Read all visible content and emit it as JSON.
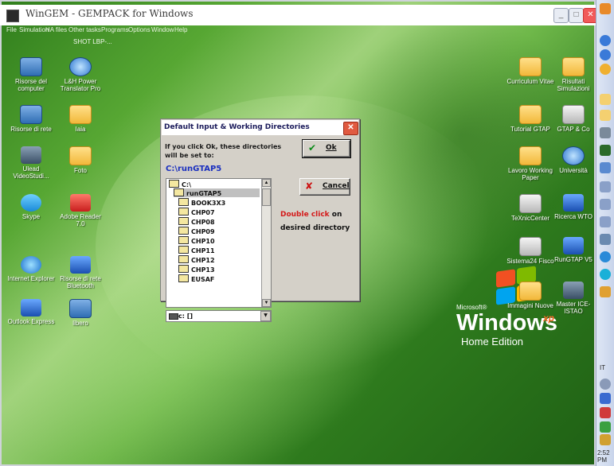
{
  "window": {
    "title": "WinGEM  -  GEMPACK for Windows",
    "menu": [
      "File",
      "Simulation",
      "HA files",
      "Other tasks",
      "Programs",
      "Options",
      "Window",
      "Help"
    ],
    "subwindow_label": "SHOT LBP-..."
  },
  "desktop_icons": [
    {
      "label": "Risorse del computer",
      "icon": "computer-icon"
    },
    {
      "label": "L&H Power Translator Pro",
      "icon": "globe-icon"
    },
    {
      "label": "Risorse di rete",
      "icon": "network-icon"
    },
    {
      "label": "Iaia",
      "icon": "folder-icon"
    },
    {
      "label": "Ulead VideoStudi...",
      "icon": "video-icon"
    },
    {
      "label": "Foto",
      "icon": "folder-icon"
    },
    {
      "label": "Skype",
      "icon": "skype-icon"
    },
    {
      "label": "Adobe Reader 7.0",
      "icon": "adobe-icon"
    },
    {
      "label": "Internet Explorer",
      "icon": "ie-icon"
    },
    {
      "label": "Risorse di rete Bluetooth",
      "icon": "bluetooth-icon"
    },
    {
      "label": "Outlook Express",
      "icon": "outlook-icon"
    },
    {
      "label": "libero",
      "icon": "libero-icon"
    },
    {
      "label": "Curriculum Vitae",
      "icon": "folder-icon"
    },
    {
      "label": "Risultati Simulazioni",
      "icon": "folder-icon"
    },
    {
      "label": "Tutorial GTAP",
      "icon": "folder-icon"
    },
    {
      "label": "GTAP & Co",
      "icon": "shortcut-icon"
    },
    {
      "label": "Lavoro Working Paper",
      "icon": "folder-icon"
    },
    {
      "label": "Università",
      "icon": "globe-icon"
    },
    {
      "label": "TeXnicCenter",
      "icon": "texnic-icon"
    },
    {
      "label": "Ricerca WTO",
      "icon": "people-icon"
    },
    {
      "label": "Sistema24 Fisco",
      "icon": "shortcut-icon"
    },
    {
      "label": "RunGTAP V5",
      "icon": "rungtap-icon"
    },
    {
      "label": "Immagini Nuove",
      "icon": "folder-icon"
    },
    {
      "label": "Master ICE-ISTAO",
      "icon": "master-icon"
    }
  ],
  "xp_logo": {
    "microsoft": "Microsoft®",
    "windows": "Windows",
    "xp": "xp",
    "edition": "Home Edition"
  },
  "dialog": {
    "title": "Default Input & Working Directories",
    "message": "If you click Ok, these directories will be set to:",
    "path": "C:\\runGTAP5",
    "ok_label": "Ok",
    "cancel_label": "Cancel",
    "hint_red": "Double click",
    "hint_black1": "on",
    "hint_black2": "desired directory",
    "directories": [
      {
        "name": "C:\\",
        "open": true
      },
      {
        "name": "runGTAP5",
        "open": true,
        "selected": true
      },
      {
        "name": "BOOK3X3"
      },
      {
        "name": "CHP07"
      },
      {
        "name": "CHP08"
      },
      {
        "name": "CHP09"
      },
      {
        "name": "CHP10"
      },
      {
        "name": "CHP11"
      },
      {
        "name": "CHP12"
      },
      {
        "name": "CHP13"
      },
      {
        "name": "EUSAF"
      }
    ],
    "drive": "c: []"
  },
  "taskbar": {
    "lang": "IT",
    "clock": "2:52 PM"
  },
  "colors": {
    "dialog_path": "#1a2fbf",
    "hint_red": "#d41a1a",
    "ok_check": "#0a8a18",
    "cancel_x": "#cc1010"
  }
}
